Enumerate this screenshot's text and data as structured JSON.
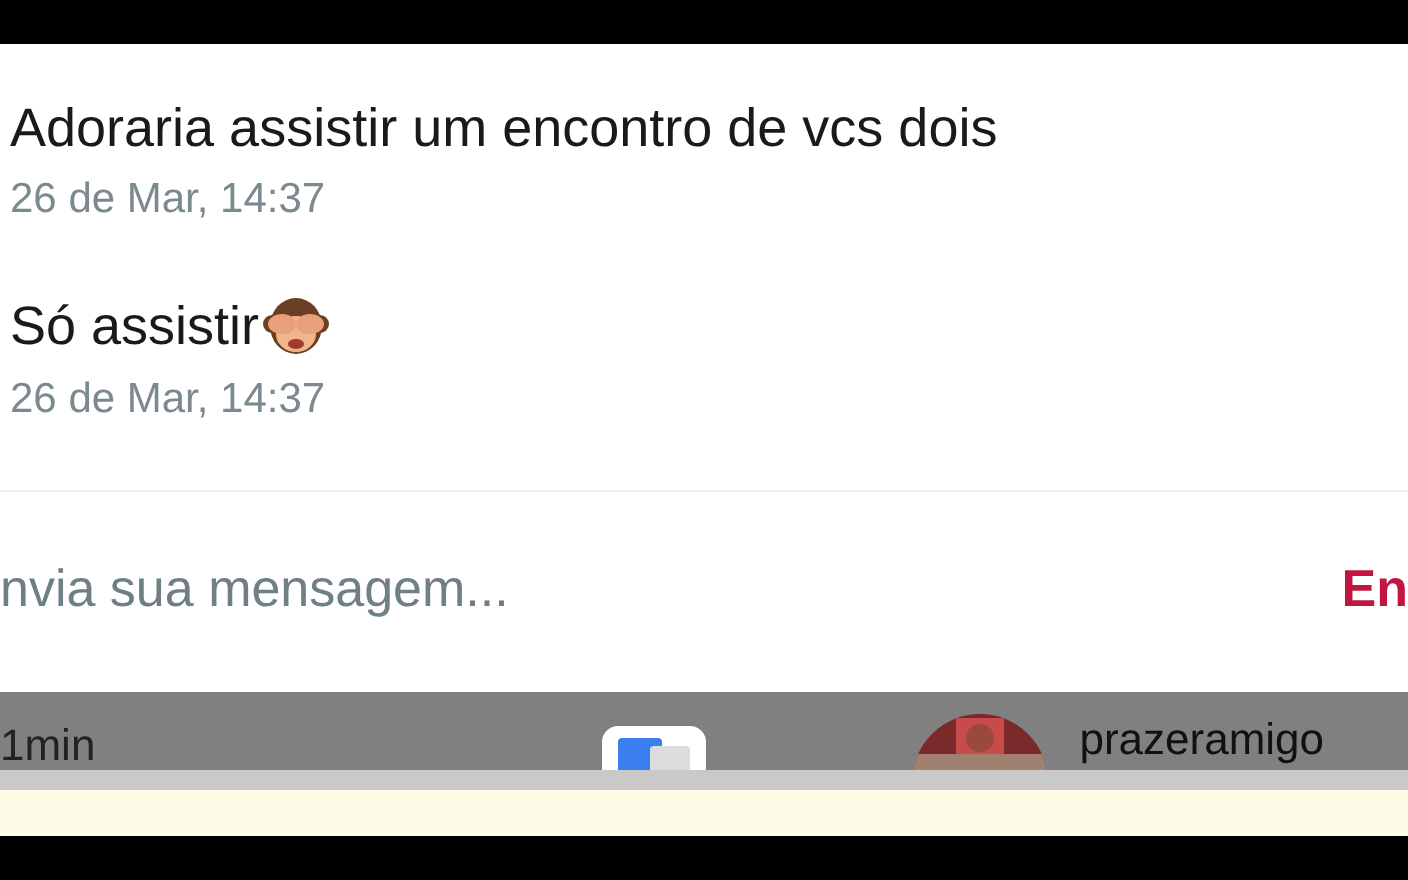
{
  "messages": [
    {
      "text": "Adoraria assistir um encontro de vcs dois",
      "time": "26 de Mar, 14:37",
      "emoji": false
    },
    {
      "text": "Só assistir",
      "time": "26 de Mar, 14:37",
      "emoji": true
    }
  ],
  "composer": {
    "placeholder": "nvia sua mensagem...",
    "send": "En"
  },
  "overlay": {
    "time": "1min",
    "username": "prazeramigo"
  }
}
